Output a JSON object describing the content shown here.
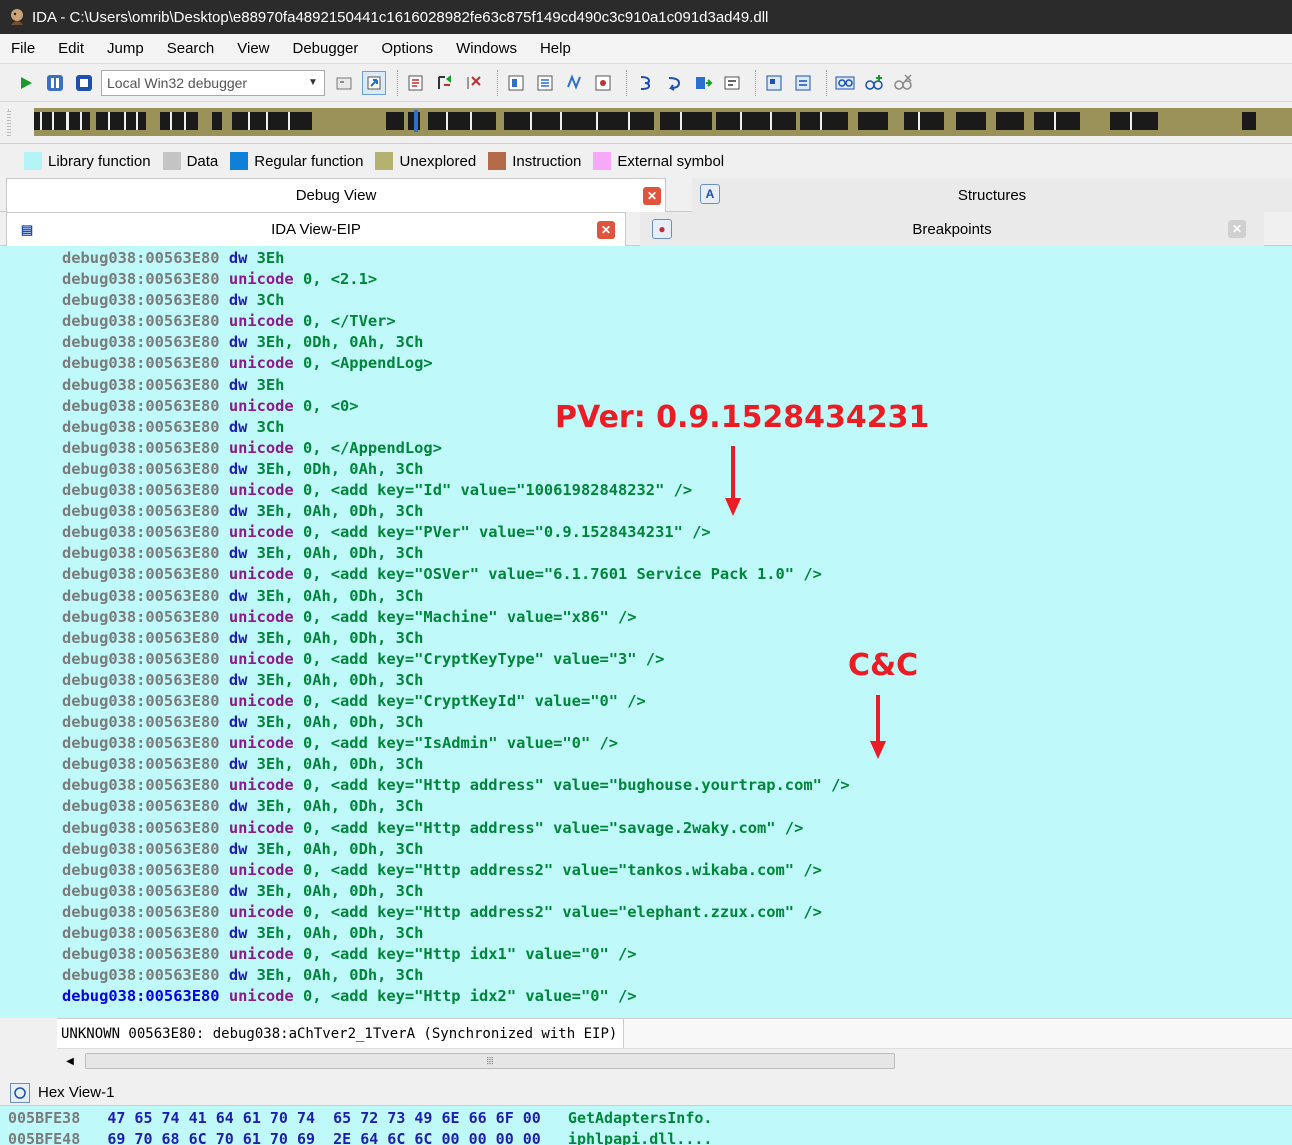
{
  "window": {
    "title": "IDA - C:\\Users\\omrib\\Desktop\\e88970fa4892150441c1616028982fe63c875f149cd490c3c910a1c091d3ad49.dll"
  },
  "menu": [
    "File",
    "Edit",
    "Jump",
    "Search",
    "View",
    "Debugger",
    "Options",
    "Windows",
    "Help"
  ],
  "toolbar": {
    "debugger_select": "Local Win32 debugger"
  },
  "legend": [
    {
      "label": "Library function",
      "color": "#b3f5f7"
    },
    {
      "label": "Data",
      "color": "#c4c4c4"
    },
    {
      "label": "Regular function",
      "color": "#0e80d8"
    },
    {
      "label": "Unexplored",
      "color": "#b5b16f"
    },
    {
      "label": "Instruction",
      "color": "#b46b47"
    },
    {
      "label": "External symbol",
      "color": "#f8a8f8"
    }
  ],
  "tabs_row1": {
    "left": "Debug View",
    "right": "Structures"
  },
  "tabs_row2": {
    "left": "IDA View-EIP",
    "right": "Breakpoints"
  },
  "disasm": {
    "lines": [
      {
        "addr": "debug038:00563E80",
        "kw": "dw",
        "ops": "3Eh"
      },
      {
        "addr": "debug038:00563E80",
        "kw": "unicode",
        "ops": "0, <2.1>"
      },
      {
        "addr": "debug038:00563E80",
        "kw": "dw",
        "ops": "3Ch"
      },
      {
        "addr": "debug038:00563E80",
        "kw": "unicode",
        "ops": "0, </TVer>"
      },
      {
        "addr": "debug038:00563E80",
        "kw": "dw",
        "ops": "3Eh, 0Dh, 0Ah, 3Ch"
      },
      {
        "addr": "debug038:00563E80",
        "kw": "unicode",
        "ops": "0, <AppendLog>"
      },
      {
        "addr": "debug038:00563E80",
        "kw": "dw",
        "ops": "3Eh"
      },
      {
        "addr": "debug038:00563E80",
        "kw": "unicode",
        "ops": "0, <0>"
      },
      {
        "addr": "debug038:00563E80",
        "kw": "dw",
        "ops": "3Ch"
      },
      {
        "addr": "debug038:00563E80",
        "kw": "unicode",
        "ops": "0, </AppendLog>"
      },
      {
        "addr": "debug038:00563E80",
        "kw": "dw",
        "ops": "3Eh, 0Dh, 0Ah, 3Ch"
      },
      {
        "addr": "debug038:00563E80",
        "kw": "unicode",
        "ops": "0, <add key=\"Id\" value=\"10061982848232\" />"
      },
      {
        "addr": "debug038:00563E80",
        "kw": "dw",
        "ops": "3Eh, 0Ah, 0Dh, 3Ch"
      },
      {
        "addr": "debug038:00563E80",
        "kw": "unicode",
        "ops": "0, <add key=\"PVer\" value=\"0.9.1528434231\" />"
      },
      {
        "addr": "debug038:00563E80",
        "kw": "dw",
        "ops": "3Eh, 0Ah, 0Dh, 3Ch"
      },
      {
        "addr": "debug038:00563E80",
        "kw": "unicode",
        "ops": "0, <add key=\"OSVer\" value=\"6.1.7601 Service Pack 1.0\" />"
      },
      {
        "addr": "debug038:00563E80",
        "kw": "dw",
        "ops": "3Eh, 0Ah, 0Dh, 3Ch"
      },
      {
        "addr": "debug038:00563E80",
        "kw": "unicode",
        "ops": "0, <add key=\"Machine\" value=\"x86\" />"
      },
      {
        "addr": "debug038:00563E80",
        "kw": "dw",
        "ops": "3Eh, 0Ah, 0Dh, 3Ch"
      },
      {
        "addr": "debug038:00563E80",
        "kw": "unicode",
        "ops": "0, <add key=\"CryptKeyType\" value=\"3\" />"
      },
      {
        "addr": "debug038:00563E80",
        "kw": "dw",
        "ops": "3Eh, 0Ah, 0Dh, 3Ch"
      },
      {
        "addr": "debug038:00563E80",
        "kw": "unicode",
        "ops": "0, <add key=\"CryptKeyId\" value=\"0\" />"
      },
      {
        "addr": "debug038:00563E80",
        "kw": "dw",
        "ops": "3Eh, 0Ah, 0Dh, 3Ch"
      },
      {
        "addr": "debug038:00563E80",
        "kw": "unicode",
        "ops": "0, <add key=\"IsAdmin\" value=\"0\" />"
      },
      {
        "addr": "debug038:00563E80",
        "kw": "dw",
        "ops": "3Eh, 0Ah, 0Dh, 3Ch"
      },
      {
        "addr": "debug038:00563E80",
        "kw": "unicode",
        "ops": "0, <add key=\"Http address\" value=\"bughouse.yourtrap.com\" />"
      },
      {
        "addr": "debug038:00563E80",
        "kw": "dw",
        "ops": "3Eh, 0Ah, 0Dh, 3Ch"
      },
      {
        "addr": "debug038:00563E80",
        "kw": "unicode",
        "ops": "0, <add key=\"Http address\" value=\"savage.2waky.com\" />"
      },
      {
        "addr": "debug038:00563E80",
        "kw": "dw",
        "ops": "3Eh, 0Ah, 0Dh, 3Ch"
      },
      {
        "addr": "debug038:00563E80",
        "kw": "unicode",
        "ops": "0, <add key=\"Http address2\" value=\"tankos.wikaba.com\" />"
      },
      {
        "addr": "debug038:00563E80",
        "kw": "dw",
        "ops": "3Eh, 0Ah, 0Dh, 3Ch"
      },
      {
        "addr": "debug038:00563E80",
        "kw": "unicode",
        "ops": "0, <add key=\"Http address2\" value=\"elephant.zzux.com\" />"
      },
      {
        "addr": "debug038:00563E80",
        "kw": "dw",
        "ops": "3Eh, 0Ah, 0Dh, 3Ch"
      },
      {
        "addr": "debug038:00563E80",
        "kw": "unicode",
        "ops": "0, <add key=\"Http idx1\" value=\"0\" />"
      },
      {
        "addr": "debug038:00563E80",
        "kw": "dw",
        "ops": "3Eh, 0Ah, 0Dh, 3Ch"
      },
      {
        "addr": "debug038:00563E80",
        "kw": "unicode",
        "ops": "0, <add key=\"Http idx2\" value=\"0\" />",
        "current": true
      }
    ]
  },
  "annotations": {
    "pver": "PVer: 0.9.1528434231",
    "cnc": "C&C"
  },
  "status": {
    "text": "UNKNOWN 00563E80: debug038:aChTver2_1TverA (Synchronized with EIP)"
  },
  "hex": {
    "title": "Hex View-1",
    "rows": [
      {
        "addr": "005BFE38",
        "bytes": "47 65 74 41 64 61 70 74  65 72 73 49 6E 66 6F 00",
        "ascii": "GetAdaptersInfo."
      },
      {
        "addr": "005BFE48",
        "bytes": "69 70 68 6C 70 61 70 69  2E 64 6C 6C 00 00 00 00",
        "ascii": "iphlpapi.dll...."
      }
    ]
  }
}
